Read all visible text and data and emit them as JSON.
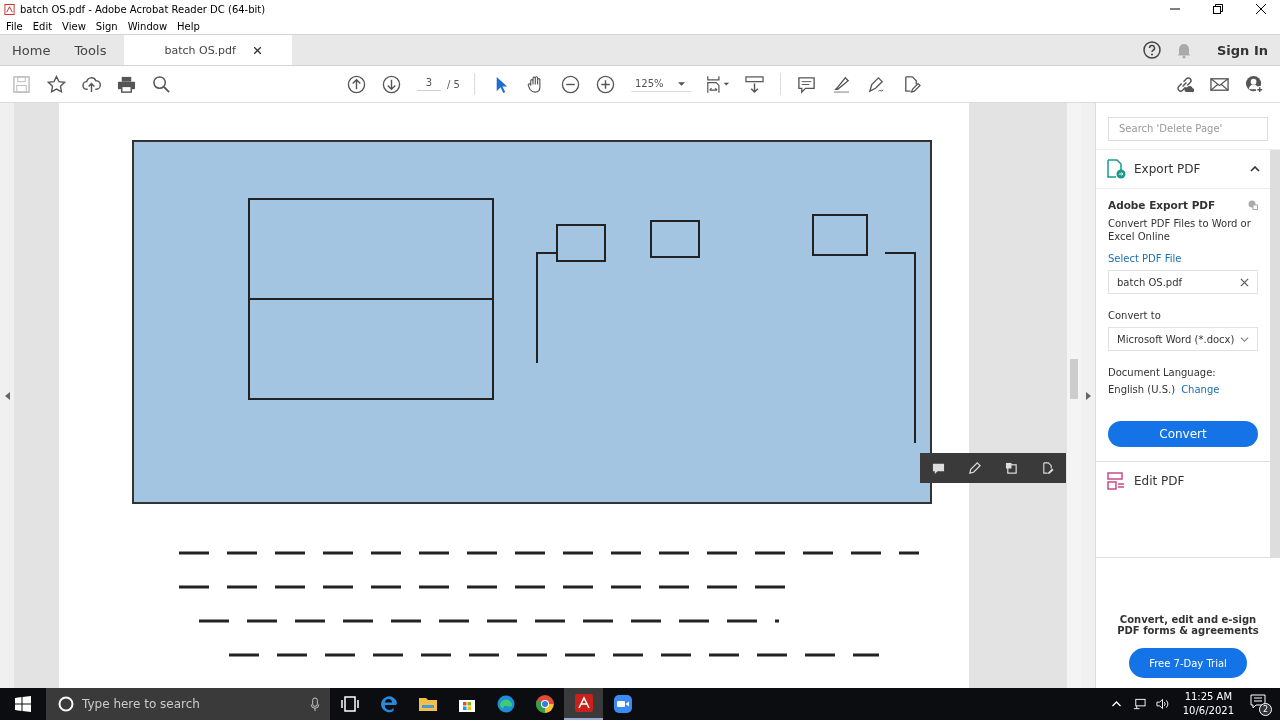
{
  "window": {
    "title": "batch OS.pdf - Adobe Acrobat Reader DC (64-bit)"
  },
  "menu": [
    "File",
    "Edit",
    "View",
    "Sign",
    "Window",
    "Help"
  ],
  "tabs": [
    {
      "label": "Home",
      "selected": false
    },
    {
      "label": "Tools",
      "selected": false
    },
    {
      "label": "batch OS.pdf",
      "selected": true
    }
  ],
  "header": {
    "sign_in": "Sign In"
  },
  "toolbar": {
    "page": "3",
    "total": "/ 5",
    "zoom": "125%"
  },
  "panel": {
    "search": {
      "placeholder": "Search 'Delete Page'"
    },
    "export": {
      "title": "Export PDF",
      "expanded": true,
      "heading": "Adobe Export PDF",
      "description": "Convert PDF Files to Word or Excel Online",
      "select_link": "Select PDF File",
      "file": "batch OS.pdf",
      "convert_label": "Convert to",
      "format": "Microsoft Word (*.docx)",
      "language_label": "Document Language:",
      "language": "English (U.S.)",
      "change_link": "Change",
      "button": "Convert"
    },
    "edit": {
      "title": "Edit PDF"
    },
    "promo": {
      "text": "Convert, edit and e-sign PDF forms & agreements",
      "button": "Free 7-Day Trial"
    }
  },
  "taskbar": {
    "search": {
      "placeholder": "Type here to search"
    },
    "apps": [
      {
        "kind": "taskview",
        "selected": false
      },
      {
        "kind": "edge-legacy",
        "selected": false
      },
      {
        "kind": "explorer",
        "selected": false
      },
      {
        "kind": "store",
        "selected": false
      },
      {
        "kind": "edge",
        "selected": false
      },
      {
        "kind": "chrome",
        "selected": false
      },
      {
        "kind": "acrobat",
        "selected": true
      },
      {
        "kind": "zoom",
        "selected": false
      }
    ],
    "time": "11:25 AM",
    "date": "10/6/2021",
    "notifications": "2"
  }
}
